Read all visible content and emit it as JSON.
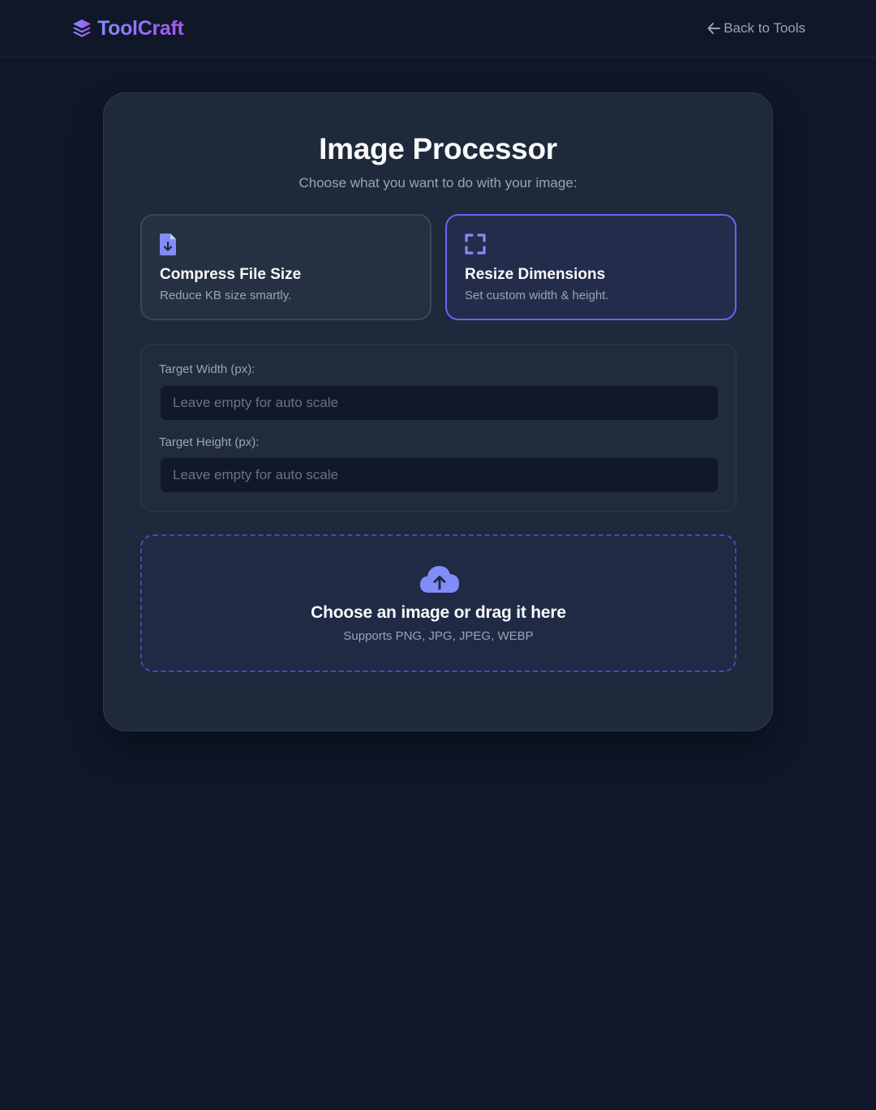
{
  "header": {
    "brand_name": "ToolCraft",
    "brand_icon": "layers-icon",
    "back_label": "Back to Tools",
    "back_icon": "arrow-left-icon"
  },
  "main": {
    "title": "Image Processor",
    "subtitle": "Choose what you want to do with your image:",
    "options": [
      {
        "icon": "file-download-icon",
        "title": "Compress File Size",
        "description": "Reduce KB size smartly.",
        "selected": false
      },
      {
        "icon": "expand-icon",
        "title": "Resize Dimensions",
        "description": "Set custom width & height.",
        "selected": true
      }
    ],
    "fields": {
      "width_label": "Target Width (px):",
      "width_placeholder": "Leave empty for auto scale",
      "width_value": "",
      "height_label": "Target Height (px):",
      "height_placeholder": "Leave empty for auto scale",
      "height_value": ""
    },
    "dropzone": {
      "icon": "cloud-upload-icon",
      "title": "Choose an image or drag it here",
      "subtitle": "Supports PNG, JPG, JPEG, WEBP"
    }
  },
  "colors": {
    "background": "#0f1729",
    "card": "#1e293b",
    "accent": "#6366f1",
    "brand_gradient_start": "#818cf8",
    "brand_gradient_end": "#a855f7"
  }
}
